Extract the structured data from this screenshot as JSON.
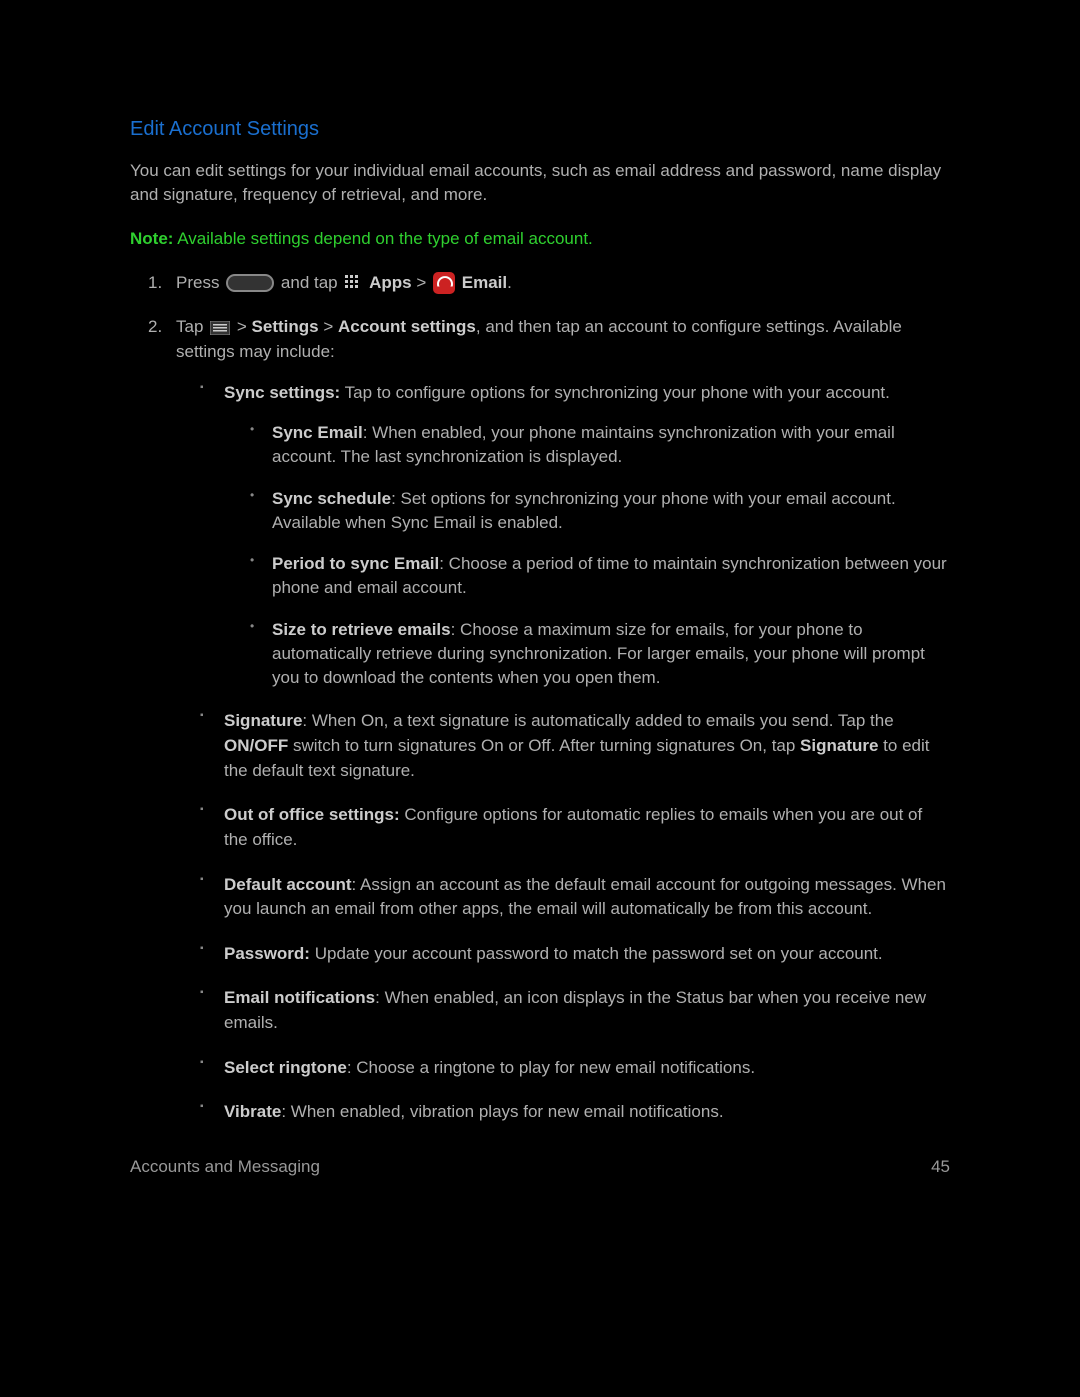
{
  "title": "Edit Account Settings",
  "intro": "You can edit settings for your individual email accounts, such as email address and password, name display and signature, frequency of retrieval, and more.",
  "note": {
    "label": "Note:",
    "text": " Available settings depend on the type of email account."
  },
  "step1": {
    "press": "Press ",
    "andtap": " and tap ",
    "apps": " Apps",
    "gt1": " > ",
    "email": " Email",
    "period": "."
  },
  "step2": {
    "tap": "Tap ",
    "gt": " > ",
    "settings": "Settings",
    "gt2": " > ",
    "acct": "Account settings",
    "rest": ", and then tap an account to configure settings. Available settings may include:"
  },
  "sync": {
    "label": "Sync settings:",
    "text": " Tap to configure options for synchronizing your phone with your account.",
    "email_l": "Sync Email",
    "email_t": ": When enabled, your phone maintains synchronization with your email account. The last synchronization is displayed.",
    "sched_l": "Sync schedule",
    "sched_t": ": Set options for synchronizing your phone with your email account. Available when Sync Email is enabled.",
    "period_l": "Period to sync Email",
    "period_t": ": Choose a period of time to maintain synchronization between your phone and email account.",
    "size_l": "Size to retrieve emails",
    "size_t": ": Choose a maximum size for emails, for your phone to automatically retrieve during synchronization. For larger emails, your phone will prompt you to download the contents when you open them."
  },
  "sig": {
    "label": "Signature",
    "t1": ": When On, a text signature is automatically added to emails you send. Tap the ",
    "onoff": "ON/OFF",
    "t2": " switch to turn signatures On or Off. After turning signatures On, tap ",
    "label2": "Signature",
    "t3": " to edit the default text signature."
  },
  "ooo": {
    "label": "Out of office settings:",
    "text": " Configure options for automatic replies to emails when you are out of the office."
  },
  "def": {
    "label": "Default account",
    "text": ": Assign an account as the default email account for outgoing messages. When you launch an email from other apps, the email will automatically be from this account."
  },
  "pwd": {
    "label": "Password:",
    "text": " Update your account password to match the password set on your account."
  },
  "notif": {
    "label": "Email notifications",
    "text": ": When enabled, an icon displays in the Status bar when you receive new emails."
  },
  "ring": {
    "label": "Select ringtone",
    "text": ": Choose a ringtone to play for new email notifications."
  },
  "vib": {
    "label": "Vibrate",
    "text": ": When enabled, vibration plays for new email notifications."
  },
  "footer": {
    "section": "Accounts and Messaging",
    "page": "45"
  }
}
